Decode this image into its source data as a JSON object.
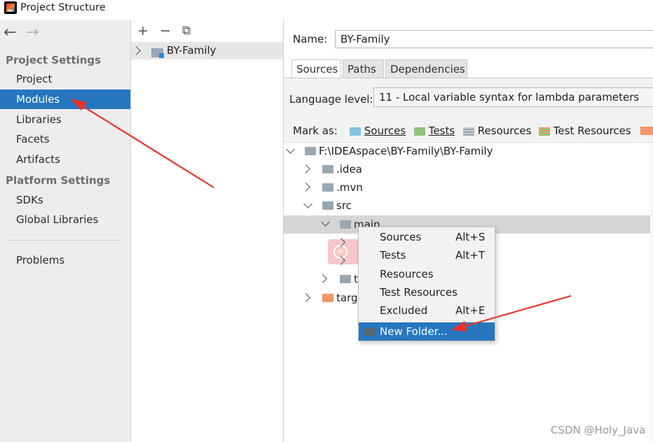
{
  "window": {
    "title": "Project Structure"
  },
  "nav": {
    "back": "←",
    "forward": "→"
  },
  "sidebar": {
    "project_settings_header": "Project Settings",
    "items": [
      {
        "label": "Project"
      },
      {
        "label": "Modules",
        "selected": true
      },
      {
        "label": "Libraries"
      },
      {
        "label": "Facets"
      },
      {
        "label": "Artifacts"
      }
    ],
    "platform_settings_header": "Platform Settings",
    "platform_items": [
      {
        "label": "SDKs"
      },
      {
        "label": "Global Libraries"
      }
    ],
    "problems": "Problems"
  },
  "modules": {
    "toolbar": {
      "add": "+",
      "remove": "−",
      "copy": "⧉"
    },
    "items": [
      {
        "label": "BY-Family"
      }
    ]
  },
  "module_detail": {
    "name_label": "Name:",
    "name_value": "BY-Family",
    "tabs": [
      {
        "label": "Sources",
        "selected": true
      },
      {
        "label": "Paths"
      },
      {
        "label": "Dependencies"
      }
    ],
    "language_level_label": "Language level:",
    "language_level_value": "11 - Local variable syntax for lambda parameters",
    "mark_as_label": "Mark as:",
    "mark_as": {
      "sources": "Sources",
      "tests": "Tests",
      "resources": "Resources",
      "test_resources": "Test Resources"
    },
    "tree": {
      "root": "F:\\IDEAspace\\BY-Family\\BY-Family",
      "idea": ".idea",
      "mvn": ".mvn",
      "src": "src",
      "main": "main",
      "test_partial": "t",
      "target_partial": "targ"
    }
  },
  "context_menu": {
    "items": [
      {
        "label": "Sources",
        "shortcut": "Alt+S"
      },
      {
        "label": "Tests",
        "shortcut": "Alt+T"
      },
      {
        "label": "Resources",
        "shortcut": ""
      },
      {
        "label": "Test Resources",
        "shortcut": ""
      },
      {
        "label": "Excluded",
        "shortcut": "Alt+E"
      },
      {
        "label": "New Folder...",
        "shortcut": "",
        "selected": true
      }
    ]
  },
  "watermark": "CSDN @Holy_Java",
  "colors": {
    "selection": "#2675bf",
    "annotation_arrow": "#e8342a",
    "folder_gray": "#9aa7b0",
    "folder_source": "#7ec3e6",
    "folder_test": "#8fc27c",
    "folder_excluded": "#f4956a"
  }
}
